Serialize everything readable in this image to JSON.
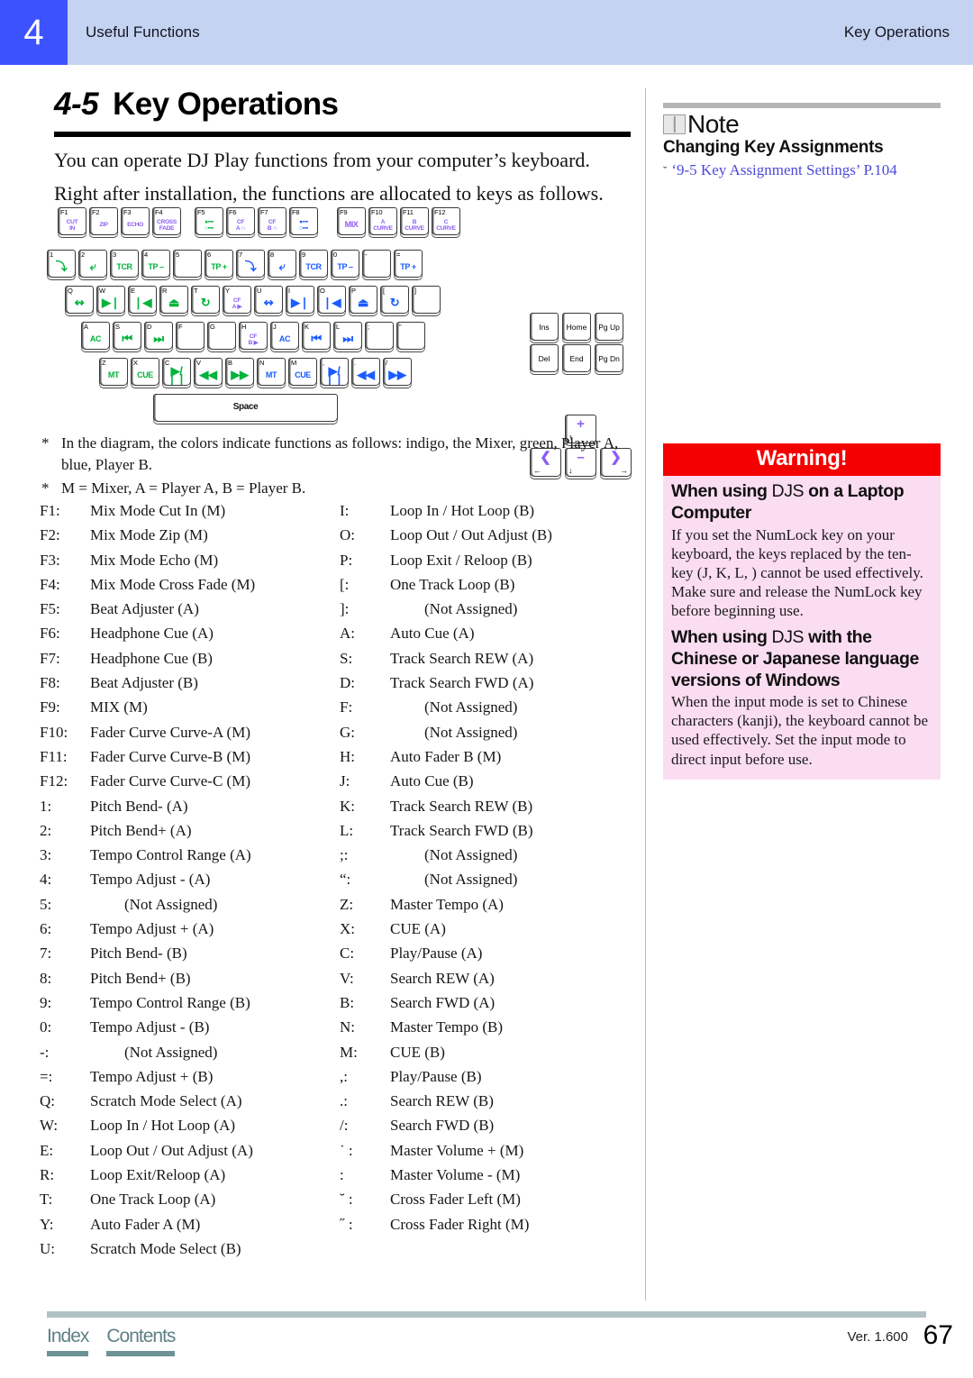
{
  "header": {
    "chapter_number": "4",
    "chapter_name": "Useful Functions",
    "section_name": "Key Operations"
  },
  "title": {
    "number": "4-5",
    "text": "Key Operations"
  },
  "intro": {
    "line1": "You can operate DJ Play functions from your computer’s keyboard.",
    "line2": "Right after installation, the functions are allocated to keys as follows."
  },
  "footnotes": {
    "asterisk": "*",
    "note1": "In the diagram, the colors indicate functions as follows: indigo, the Mixer, green, Player A, blue, Player B.",
    "note2": "M = Mixer, A = Player A, B = Player B."
  },
  "keyboard": {
    "function_row": [
      {
        "label": "F1",
        "fn": "CUT\nIN",
        "color": "m",
        "size": "sm"
      },
      {
        "label": "F2",
        "fn": "ZIP",
        "color": "m",
        "size": "sm"
      },
      {
        "label": "F3",
        "fn": "ECHO",
        "color": "m",
        "size": "sm"
      },
      {
        "label": "F4",
        "fn": "CROSS\nFADE",
        "color": "m",
        "size": "sm"
      },
      {
        "gap": "s"
      },
      {
        "label": "F5",
        "fn": "●▪▪▪\n○▪▪▪",
        "color": "a",
        "size": "sm"
      },
      {
        "label": "F6",
        "fn": "CF\nA ∩",
        "color": "m",
        "size": "sm"
      },
      {
        "label": "F7",
        "fn": "CF\nB ∩",
        "color": "m",
        "size": "sm"
      },
      {
        "label": "F8",
        "fn": "●▪▪▪\n○▪▪▪",
        "color": "b",
        "size": "sm"
      },
      {
        "gap": "m"
      },
      {
        "label": "F9",
        "fn": "MIX",
        "color": "m",
        "size": "md"
      },
      {
        "label": "F10",
        "fn": "A\nCURVE",
        "color": "m",
        "size": "sm"
      },
      {
        "label": "F11",
        "fn": "B\nCURVE",
        "color": "m",
        "size": "sm"
      },
      {
        "label": "F12",
        "fn": "C\nCURVE",
        "color": "m",
        "size": "sm"
      }
    ],
    "number_row": [
      {
        "label": "1",
        "fn": "⤵",
        "color": "a",
        "size": "glyph"
      },
      {
        "label": "2",
        "fn": "⤶",
        "color": "a",
        "size": "glyph"
      },
      {
        "label": "3",
        "fn": "TCR",
        "color": "a",
        "size": "md"
      },
      {
        "label": "4",
        "fn": "TP –",
        "color": "a",
        "size": "md"
      },
      {
        "label": "5",
        "fn": "",
        "color": "a",
        "size": "md"
      },
      {
        "label": "6",
        "fn": "TP +",
        "color": "a",
        "size": "md"
      },
      {
        "label": "7",
        "fn": "⤵",
        "color": "b",
        "size": "glyph"
      },
      {
        "label": "8",
        "fn": "⤶",
        "color": "b",
        "size": "glyph"
      },
      {
        "label": "9",
        "fn": "TCR",
        "color": "b",
        "size": "md"
      },
      {
        "label": "0",
        "fn": "TP –",
        "color": "b",
        "size": "md"
      },
      {
        "label": "-",
        "fn": "",
        "color": "b",
        "size": "md"
      },
      {
        "label": "=",
        "fn": "TP +",
        "color": "b",
        "size": "md"
      }
    ],
    "qwerty_row": [
      {
        "label": "Q",
        "fn": "↭",
        "color": "a",
        "size": "glyph"
      },
      {
        "label": "W",
        "fn": "▶❘",
        "color": "a",
        "size": "glyph"
      },
      {
        "label": "E",
        "fn": "❘◀",
        "color": "a",
        "size": "glyph"
      },
      {
        "label": "R",
        "fn": "⏏",
        "color": "a",
        "size": "glyph"
      },
      {
        "label": "T",
        "fn": "↻",
        "color": "a",
        "size": "glyph"
      },
      {
        "label": "Y",
        "fn": "CF\nA ▶",
        "color": "m",
        "size": "sm"
      },
      {
        "label": "U",
        "fn": "↭",
        "color": "b",
        "size": "glyph"
      },
      {
        "label": "I",
        "fn": "▶❘",
        "color": "b",
        "size": "glyph"
      },
      {
        "label": "O",
        "fn": "❘◀",
        "color": "b",
        "size": "glyph"
      },
      {
        "label": "P",
        "fn": "⏏",
        "color": "b",
        "size": "glyph"
      },
      {
        "label": "[",
        "fn": "↻",
        "color": "b",
        "size": "glyph"
      },
      {
        "label": "]",
        "fn": "",
        "color": "b",
        "size": "md"
      }
    ],
    "home_row": [
      {
        "label": "A",
        "fn": "AC",
        "color": "a",
        "size": "md"
      },
      {
        "label": "S",
        "fn": "⏮",
        "color": "a",
        "size": "glyph"
      },
      {
        "label": "D",
        "fn": "⏭",
        "color": "a",
        "size": "glyph"
      },
      {
        "label": "F",
        "fn": "",
        "color": "a",
        "size": "md"
      },
      {
        "label": "G",
        "fn": "",
        "color": "a",
        "size": "md"
      },
      {
        "label": "H",
        "fn": "CF\nB ▶",
        "color": "m",
        "size": "sm"
      },
      {
        "label": "J",
        "fn": "AC",
        "color": "b",
        "size": "md"
      },
      {
        "label": "K",
        "fn": "⏮",
        "color": "b",
        "size": "glyph"
      },
      {
        "label": "L",
        "fn": "⏭",
        "color": "b",
        "size": "glyph"
      },
      {
        "label": ";",
        "fn": "",
        "color": "b",
        "size": "md"
      },
      {
        "label": "\"",
        "fn": "",
        "color": "b",
        "size": "md"
      }
    ],
    "bottom_row": [
      {
        "label": "Z",
        "fn": "MT",
        "color": "a",
        "size": "md"
      },
      {
        "label": "X",
        "fn": "CUE",
        "color": "a",
        "size": "md"
      },
      {
        "label": "C",
        "fn": "▶/❘❘",
        "color": "a",
        "size": "glyph"
      },
      {
        "label": "V",
        "fn": "◀◀",
        "color": "a",
        "size": "glyph"
      },
      {
        "label": "B",
        "fn": "▶▶",
        "color": "a",
        "size": "glyph"
      },
      {
        "label": "N",
        "fn": "MT",
        "color": "b",
        "size": "md"
      },
      {
        "label": "M",
        "fn": "CUE",
        "color": "b",
        "size": "md"
      },
      {
        "label": ",",
        "fn": "▶/❘❘",
        "color": "b",
        "size": "glyph"
      },
      {
        "label": ".",
        "fn": "◀◀",
        "color": "b",
        "size": "glyph"
      },
      {
        "label": "/",
        "fn": "▶▶",
        "color": "b",
        "size": "glyph"
      }
    ],
    "space_label": "Space",
    "nav_cluster": [
      [
        "Ins",
        "Home",
        "Pg Up"
      ],
      [
        "Del",
        "End",
        "Pg Dn"
      ]
    ],
    "arrow_cluster": {
      "up": {
        "big": "+",
        "sm": "↑"
      },
      "left": {
        "big": "❮",
        "sm": "←"
      },
      "down": {
        "big": "–",
        "sm": "↓"
      },
      "right": {
        "big": "❯",
        "sm": "→"
      }
    }
  },
  "assignments_left": [
    {
      "key": "F1:",
      "fn": "Mix Mode Cut In (M)"
    },
    {
      "key": "F2:",
      "fn": "Mix Mode Zip (M)"
    },
    {
      "key": "F3:",
      "fn": "Mix Mode Echo (M)"
    },
    {
      "key": "F4:",
      "fn": "Mix Mode Cross Fade (M)"
    },
    {
      "key": "F5:",
      "fn": "Beat Adjuster (A)"
    },
    {
      "key": "F6:",
      "fn": "Headphone Cue (A)"
    },
    {
      "key": "F7:",
      "fn": "Headphone Cue (B)"
    },
    {
      "key": "F8:",
      "fn": "Beat Adjuster (B)"
    },
    {
      "key": "F9:",
      "fn": "MIX (M)"
    },
    {
      "key": "F10:",
      "fn": "Fader Curve Curve-A (M)"
    },
    {
      "key": "F11:",
      "fn": "Fader Curve Curve-B (M)"
    },
    {
      "key": "F12:",
      "fn": "Fader Curve Curve-C (M)"
    },
    {
      "key": "1:",
      "fn": "Pitch Bend- (A)"
    },
    {
      "key": "2:",
      "fn": "Pitch Bend+ (A)"
    },
    {
      "key": "3:",
      "fn": "Tempo Control Range (A)"
    },
    {
      "key": "4:",
      "fn": "Tempo Adjust - (A)"
    },
    {
      "key": "5:",
      "fn": "(Not Assigned)",
      "indent": true
    },
    {
      "key": "6:",
      "fn": "Tempo Adjust + (A)"
    },
    {
      "key": "7:",
      "fn": "Pitch Bend- (B)"
    },
    {
      "key": "8:",
      "fn": "Pitch Bend+ (B)"
    },
    {
      "key": "9:",
      "fn": "Tempo Control Range (B)"
    },
    {
      "key": "0:",
      "fn": "Tempo Adjust - (B)"
    },
    {
      "key": "-:",
      "fn": "(Not Assigned)",
      "indent": true
    },
    {
      "key": "=:",
      "fn": "Tempo Adjust + (B)"
    },
    {
      "key": "Q:",
      "fn": "Scratch Mode Select (A)"
    },
    {
      "key": "W:",
      "fn": "Loop In / Hot Loop (A)"
    },
    {
      "key": "E:",
      "fn": "Loop Out / Out Adjust (A)"
    },
    {
      "key": "R:",
      "fn": "Loop Exit/Reloop (A)"
    },
    {
      "key": "T:",
      "fn": "One Track Loop (A)"
    },
    {
      "key": "Y:",
      "fn": "Auto Fader A (M)"
    },
    {
      "key": "U:",
      "fn": "Scratch Mode Select (B)"
    }
  ],
  "assignments_right": [
    {
      "key": "I:",
      "fn": "Loop In / Hot Loop (B)"
    },
    {
      "key": "O:",
      "fn": "Loop Out / Out Adjust (B)"
    },
    {
      "key": "P:",
      "fn": "Loop Exit / Reloop (B)"
    },
    {
      "key": "[:",
      "fn": "One Track Loop (B)"
    },
    {
      "key": "]:",
      "fn": "(Not Assigned)",
      "indent": true
    },
    {
      "key": "A:",
      "fn": "Auto Cue (A)"
    },
    {
      "key": "S:",
      "fn": "Track Search REW (A)"
    },
    {
      "key": "D:",
      "fn": "Track Search FWD (A)"
    },
    {
      "key": "F:",
      "fn": "(Not Assigned)",
      "indent": true
    },
    {
      "key": "G:",
      "fn": "(Not Assigned)",
      "indent": true
    },
    {
      "key": "H:",
      "fn": "Auto Fader B (M)"
    },
    {
      "key": "J:",
      "fn": "Auto Cue (B)"
    },
    {
      "key": "K:",
      "fn": "Track Search REW (B)"
    },
    {
      "key": "L:",
      "fn": "Track Search FWD (B)"
    },
    {
      "key": ";:",
      "fn": "(Not Assigned)",
      "indent": true
    },
    {
      "key": "“:",
      "fn": "(Not Assigned)",
      "indent": true
    },
    {
      "key": "Z:",
      "fn": "Master Tempo (A)"
    },
    {
      "key": "X:",
      "fn": "CUE (A)"
    },
    {
      "key": "C:",
      "fn": "Play/Pause (A)"
    },
    {
      "key": "V:",
      "fn": "Search REW (A)"
    },
    {
      "key": "B:",
      "fn": "Search FWD (A)"
    },
    {
      "key": "N:",
      "fn": "Master Tempo (B)"
    },
    {
      "key": "M:",
      "fn": "CUE (B)"
    },
    {
      "key": ",:",
      "fn": "Play/Pause (B)"
    },
    {
      "key": ".:",
      "fn": "Search REW (B)"
    },
    {
      "key": "/:",
      "fn": "Search FWD (B)"
    },
    {
      "key": "˙ :",
      "fn": "Master Volume + (M)"
    },
    {
      "key": " :",
      "fn": "Master Volume - (M)"
    },
    {
      "key": "˘ :",
      "fn": "Cross Fader Left (M)"
    },
    {
      "key": "˝ :",
      "fn": "Cross Fader Right (M)"
    }
  ],
  "note_box": {
    "icon": "book-icon",
    "title": "Note",
    "subtitle": "Changing Key Assignments",
    "link_caret": "ˇ",
    "link_text": "‘9-5  Key Assignment Settings’",
    "link_page": "P.104"
  },
  "warning_box": {
    "header": "Warning!",
    "h1_a": "When using ",
    "h1_b": "DJS",
    "h1_c": " on a Laptop Computer",
    "p1": "If you set the NumLock key on your keyboard, the keys replaced by the ten-key (J, K, L,     ) cannot be used effectively. Make sure and release the NumLock key before beginning use.",
    "h2_a": "When using ",
    "h2_b": "DJS",
    "h2_c": " with the Chinese or Japanese language versions of Windows",
    "p2": "When the input mode is set to Chinese characters (kanji), the keyboard cannot be used effectively. Set the input mode to direct input before use."
  },
  "footer": {
    "index_label": "Index",
    "contents_label": "Contents",
    "version": "Ver.  1.600",
    "page_number": "67"
  },
  "colors": {
    "chapter_tab": "#3d52ff",
    "header_band": "#c5d3f2",
    "mixer_indigo": "#8b5cf6",
    "player_a_green": "#00b33c",
    "player_b_blue": "#1a5cff",
    "warning_header": "#f50000",
    "warning_body": "#fbddf2",
    "footer_rule": "#b2c1c4",
    "link_blue": "#4a4ad8"
  }
}
